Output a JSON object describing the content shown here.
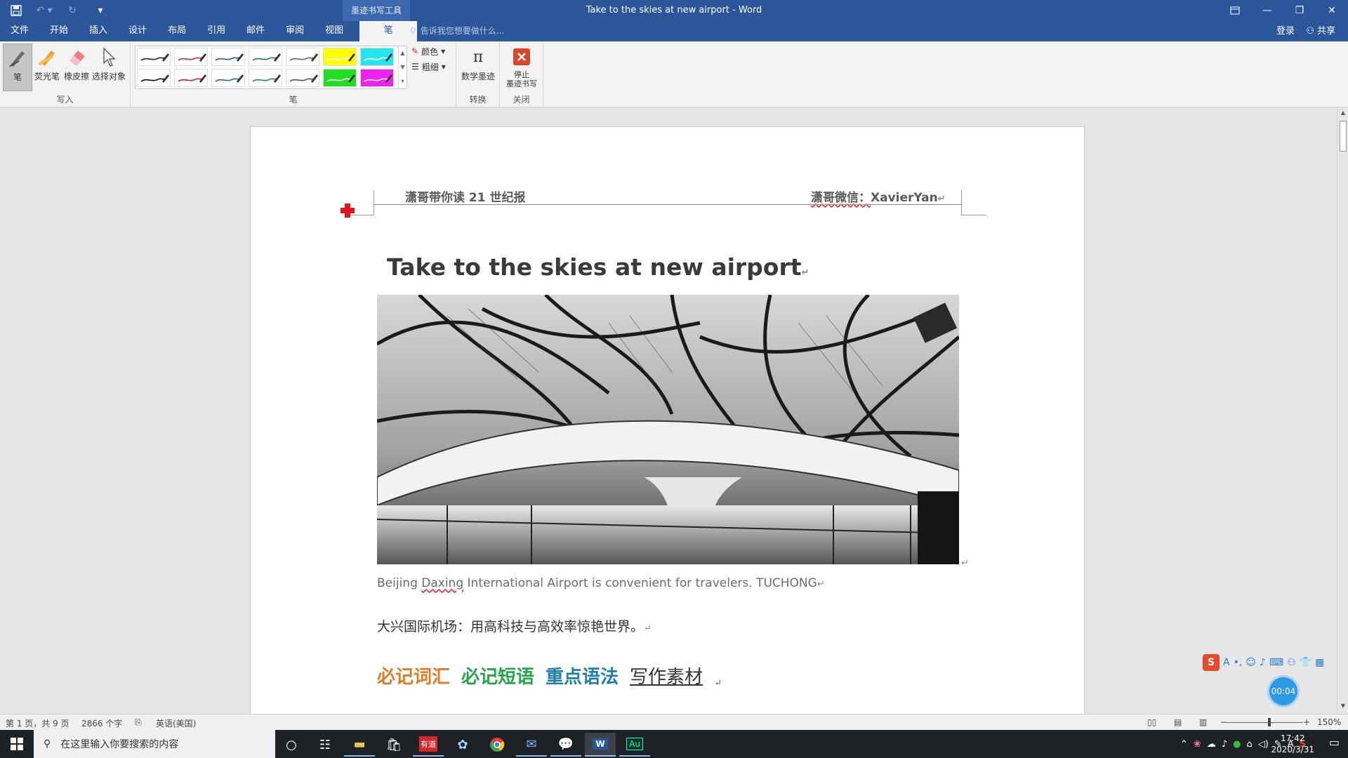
{
  "window": {
    "title": "Take to the skies at new airport - Word",
    "context_tools": "墨迹书写工具"
  },
  "tabs": [
    {
      "label": "文件"
    },
    {
      "label": "开始"
    },
    {
      "label": "插入"
    },
    {
      "label": "设计"
    },
    {
      "label": "布局"
    },
    {
      "label": "引用"
    },
    {
      "label": "邮件"
    },
    {
      "label": "审阅"
    },
    {
      "label": "视图"
    },
    {
      "label": "笔"
    }
  ],
  "tellme": "告诉我您想要做什么...",
  "account": {
    "signin": "登录",
    "share": "共享"
  },
  "ribbon": {
    "write_group": {
      "label": "写入",
      "pen": "笔",
      "highlighter": "荧光笔",
      "eraser": "橡皮擦",
      "select": "选择对象"
    },
    "pens_group": {
      "label": "笔",
      "color": "颜色",
      "thickness": "粗细"
    },
    "convert_group": {
      "label": "转换",
      "math": "数学墨迹"
    },
    "close_group": {
      "label": "关闭",
      "stop_line1": "停止",
      "stop_line2": "墨迹书写"
    },
    "pen_colors": [
      "#222222",
      "#c0303a",
      "#2a5a8c",
      "#2a7a4a",
      "#666666",
      "#ffff00",
      "#22e5ee",
      "#111111",
      "#d02020",
      "#1a6aa0",
      "#2a8a50",
      "#555555",
      "#22dd22",
      "#ee22ee"
    ]
  },
  "document": {
    "header_left": "潇哥带你读 21 世纪报",
    "header_right_prefix": "潇哥微信：",
    "header_right_name": "XavierYan",
    "title": "Take to the skies at new airport",
    "caption_before": "Beijing ",
    "caption_squiggle": "Daxing",
    "caption_after": " International Airport is convenient for travelers. TUCHONG",
    "cn_line": "大兴国际机场：用高科技与高效率惊艳世界。",
    "sections": [
      "必记词汇",
      "必记短语",
      "重点语法",
      "写作素材"
    ],
    "para_mark": "↵"
  },
  "timer": "00:04",
  "statusbar": {
    "page": "第 1 页，共 9 页",
    "words": "2866 个字",
    "language": "英语(美国)",
    "zoom": "150%"
  },
  "taskbar": {
    "search_placeholder": "在这里输入你要搜索的内容",
    "time": "17:42",
    "date": "2020/3/31"
  }
}
